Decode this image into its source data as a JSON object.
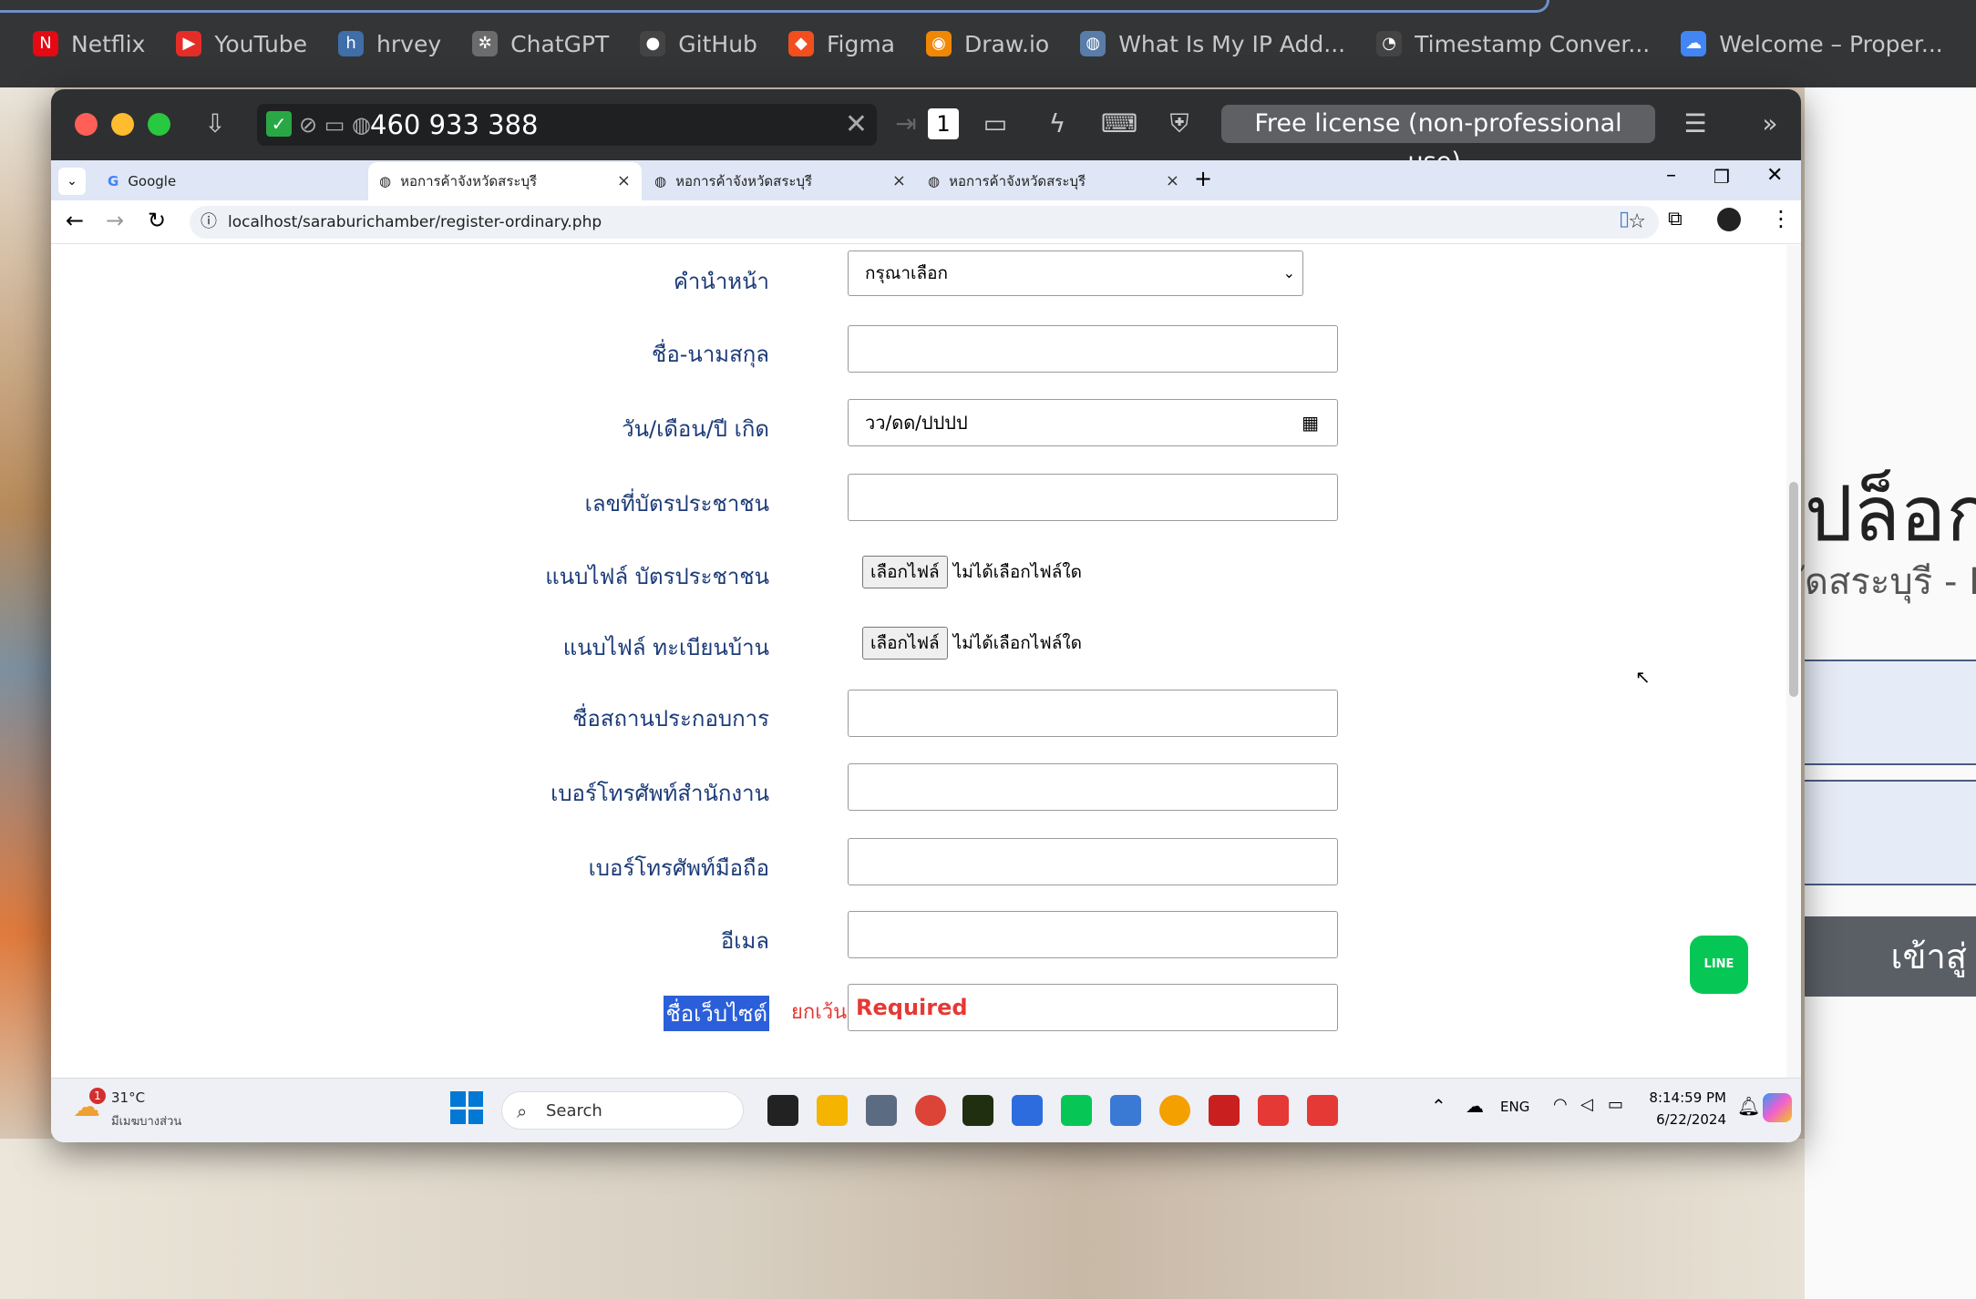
{
  "bookmarks": [
    {
      "label": "Netflix",
      "icon": "netflix-icon",
      "color": "#e50914",
      "glyph": "N"
    },
    {
      "label": "YouTube",
      "icon": "youtube-icon",
      "color": "#e52d27",
      "glyph": "▶"
    },
    {
      "label": "hrvey",
      "icon": "hrvey-icon",
      "color": "#3f6ea8",
      "glyph": "h"
    },
    {
      "label": "ChatGPT",
      "icon": "chatgpt-icon",
      "color": "#6c6c6c",
      "glyph": "✲"
    },
    {
      "label": "GitHub",
      "icon": "github-icon",
      "color": "#444",
      "glyph": "●"
    },
    {
      "label": "Figma",
      "icon": "figma-icon",
      "color": "#f24e1e",
      "glyph": "◆"
    },
    {
      "label": "Draw.io",
      "icon": "drawio-icon",
      "color": "#f08705",
      "glyph": "◉"
    },
    {
      "label": "What Is My IP Add...",
      "icon": "globe-icon",
      "color": "#5a7ca8",
      "glyph": "◍"
    },
    {
      "label": "Timestamp Conver...",
      "icon": "clock-icon",
      "color": "#444",
      "glyph": "◔"
    },
    {
      "label": "Welcome – Proper...",
      "icon": "cloud-icon",
      "color": "#4285f4",
      "glyph": "☁"
    }
  ],
  "remote": {
    "id": "460 933 388",
    "license": "Free license (non-professional use)."
  },
  "browser": {
    "tabs": [
      {
        "label": "Google"
      },
      {
        "label": "หอการค้าจังหวัดสระบุรี"
      },
      {
        "label": "หอการค้าจังหวัดสระบุรี"
      },
      {
        "label": "หอการค้าจังหวัดสระบุรี"
      }
    ],
    "url": "localhost/saraburichamber/register-ordinary.php"
  },
  "form": {
    "prefix_label": "คำนำหน้า",
    "prefix_value": "กรุณาเลือก",
    "name_label": "ชื่อ-นามสกุล",
    "dob_label": "วัน/เดือน/ปี เกิด",
    "dob_placeholder": "วว/ดด/ปปปป",
    "idcard_label": "เลขที่บัตรประชาชน",
    "idcard_file_label": "แนบไฟล์ บัตรประชาชน",
    "house_file_label": "แนบไฟล์ ทะเบียนบ้าน",
    "file_button": "เลือกไฟล์",
    "file_none": "ไม่ได้เลือกไฟล์ใด",
    "business_label": "ชื่อสถานประกอบการ",
    "office_phone_label": "เบอร์โทรศัพท์สำนักงาน",
    "mobile_label": "เบอร์โทรศัพท์มือถือ",
    "email_label": "อีเมล",
    "website_label": "ชื่อเว็บไซต์",
    "website_except": "ยกเว้น",
    "website_required": "Required"
  },
  "line_button": "LINE",
  "background_page": {
    "heading": "ปล็อกอิ",
    "subheading": "ัดสระบุรี - E",
    "button": "เข้าสู่"
  },
  "taskbar": {
    "weather_temp": "31°C",
    "weather_desc": "มีเมฆบางส่วน",
    "weather_badge": "1",
    "search": "Search",
    "lang": "ENG",
    "time": "8:14:59 PM",
    "date": "6/22/2024"
  }
}
